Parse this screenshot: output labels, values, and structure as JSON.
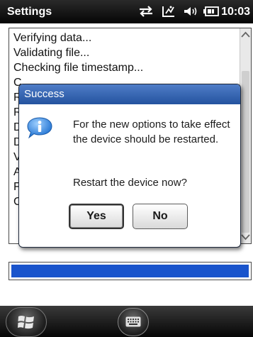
{
  "titlebar": {
    "title": "Settings",
    "time": "10:03",
    "icons": [
      "sync-icon",
      "signal-icon",
      "volume-icon",
      "battery-icon"
    ]
  },
  "log": {
    "lines": [
      "Verifying data...",
      "Validating file...",
      "Checking file timestamp...",
      "C",
      "R",
      "R",
      "D",
      "D",
      "V",
      "A",
      "F",
      "C"
    ]
  },
  "dialog": {
    "title": "Success",
    "message": "For the new options to take effect the device should be restarted.",
    "question": "Restart the device now?",
    "yes_label": "Yes",
    "no_label": "No",
    "icon": "info-icon"
  },
  "progress": {
    "value_percent": 100,
    "color": "#1954cc"
  },
  "taskbar": {
    "icons": [
      "windows-start-icon",
      "keyboard-icon"
    ]
  }
}
